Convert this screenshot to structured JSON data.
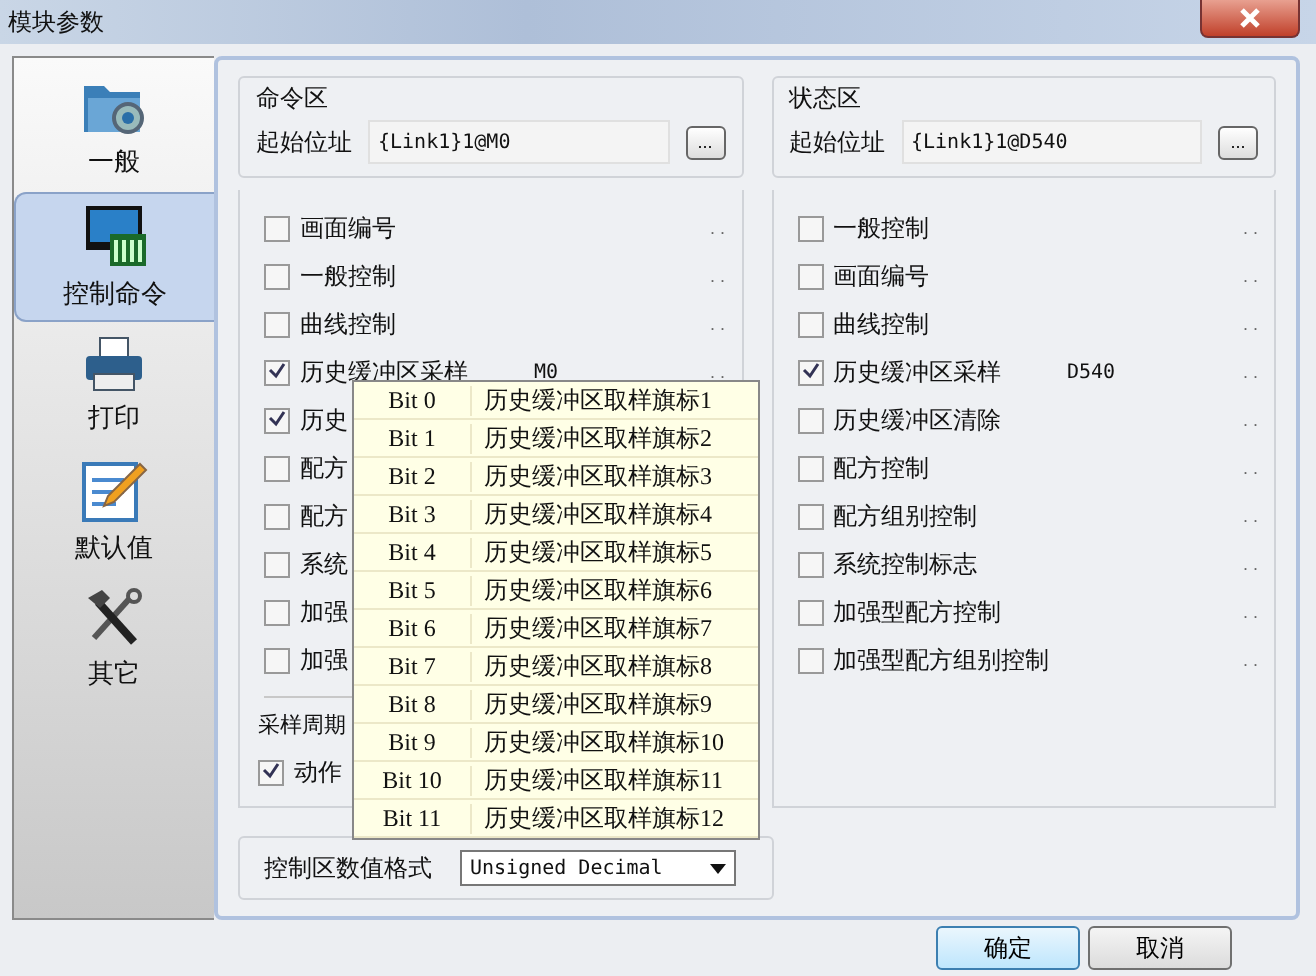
{
  "window": {
    "title": "模块参数"
  },
  "sidebar": {
    "items": [
      {
        "label": "一般",
        "selected": false
      },
      {
        "label": "控制命令",
        "selected": true
      },
      {
        "label": "打印",
        "selected": false
      },
      {
        "label": "默认值",
        "selected": false
      },
      {
        "label": "其它",
        "selected": false
      }
    ]
  },
  "command_area": {
    "title": "命令区",
    "address_label": "起始位址",
    "address": "{Link1}1@M0",
    "browse": "...",
    "items": [
      {
        "label": "画面编号",
        "checked": false,
        "more": ". ."
      },
      {
        "label": "一般控制",
        "checked": false,
        "more": ". ."
      },
      {
        "label": "曲线控制",
        "checked": false,
        "more": ". ."
      },
      {
        "label": "历史缓冲区采样",
        "checked": true,
        "value": "M0",
        "more": ". ."
      },
      {
        "label": "历史",
        "checked": true
      },
      {
        "label": "配方",
        "checked": false
      },
      {
        "label": "配方",
        "checked": false
      },
      {
        "label": "系统",
        "checked": false
      },
      {
        "label": "加强",
        "checked": false
      },
      {
        "label": "加强",
        "checked": false
      }
    ],
    "sampling_label": "采样周期",
    "action": {
      "label": "动作",
      "checked": true
    }
  },
  "status_area": {
    "title": "状态区",
    "address_label": "起始位址",
    "address": "{Link1}1@D540",
    "browse": "...",
    "items": [
      {
        "label": "一般控制",
        "checked": false,
        "more": ". ."
      },
      {
        "label": "画面编号",
        "checked": false,
        "more": ". ."
      },
      {
        "label": "曲线控制",
        "checked": false,
        "more": ". ."
      },
      {
        "label": "历史缓冲区采样",
        "checked": true,
        "value": "D540",
        "more": ". ."
      },
      {
        "label": "历史缓冲区清除",
        "checked": false,
        "more": ". ."
      },
      {
        "label": "配方控制",
        "checked": false,
        "more": ". ."
      },
      {
        "label": "配方组别控制",
        "checked": false,
        "more": ". ."
      },
      {
        "label": "系统控制标志",
        "checked": false,
        "more": ". ."
      },
      {
        "label": "加强型配方控制",
        "checked": false,
        "more": ". ."
      },
      {
        "label": "加强型配方组别控制",
        "checked": false,
        "more": ". ."
      }
    ]
  },
  "format": {
    "label": "控制区数值格式",
    "value": "Unsigned Decimal"
  },
  "popup": {
    "rows": [
      {
        "bit": "Bit 0",
        "name": "历史缓冲区取样旗标1"
      },
      {
        "bit": "Bit 1",
        "name": "历史缓冲区取样旗标2"
      },
      {
        "bit": "Bit 2",
        "name": "历史缓冲区取样旗标3"
      },
      {
        "bit": "Bit 3",
        "name": "历史缓冲区取样旗标4"
      },
      {
        "bit": "Bit 4",
        "name": "历史缓冲区取样旗标5"
      },
      {
        "bit": "Bit 5",
        "name": "历史缓冲区取样旗标6"
      },
      {
        "bit": "Bit 6",
        "name": "历史缓冲区取样旗标7"
      },
      {
        "bit": "Bit 7",
        "name": "历史缓冲区取样旗标8"
      },
      {
        "bit": "Bit 8",
        "name": "历史缓冲区取样旗标9"
      },
      {
        "bit": "Bit 9",
        "name": "历史缓冲区取样旗标10"
      },
      {
        "bit": "Bit 10",
        "name": "历史缓冲区取样旗标11"
      },
      {
        "bit": "Bit 11",
        "name": "历史缓冲区取样旗标12"
      }
    ]
  },
  "buttons": [
    "确定",
    "取消"
  ]
}
